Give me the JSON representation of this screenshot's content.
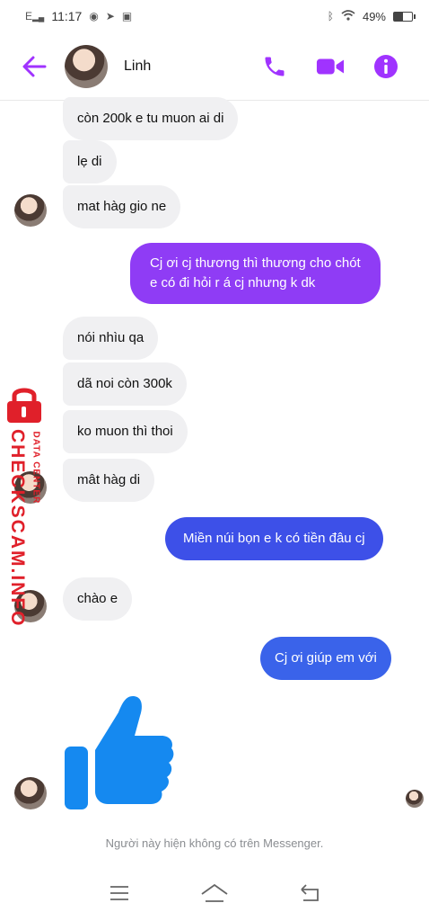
{
  "status_bar": {
    "signal_label": "E",
    "time": "11:17",
    "battery_percent": "49%",
    "battery_level": 0.49
  },
  "header": {
    "contact_name": "Linh",
    "accent_color": "#a033ff"
  },
  "messages": [
    {
      "direction": "in",
      "text": "còn 200k e tu muon ai di"
    },
    {
      "direction": "in",
      "text": "lẹ di"
    },
    {
      "direction": "in",
      "text": "mat hàg gio ne"
    },
    {
      "direction": "out",
      "text_lines": [
        "Cj ơi cj thương thì thương cho chót",
        "e có đi hỏi r á cj nhưng k dk"
      ],
      "color": "#8f3cf5"
    },
    {
      "direction": "in",
      "text": "nói nhìu qa"
    },
    {
      "direction": "in",
      "text": "dã noi còn 300k"
    },
    {
      "direction": "in",
      "text": "ko muon thì thoi"
    },
    {
      "direction": "in",
      "text": "mât hàg di"
    },
    {
      "direction": "out",
      "text": "Miền núi bọn e k có tiền đâu cj",
      "color": "#3d50e8"
    },
    {
      "direction": "in",
      "text": "chào e"
    },
    {
      "direction": "out",
      "text": "Cj ơi giúp em với",
      "color": "#3a63ea"
    },
    {
      "direction": "in",
      "sticker": "thumbs-up",
      "color": "#1589f0"
    }
  ],
  "watermark": {
    "brand": "CHECKSCAM.INFO",
    "tagline": "DATA CENTER",
    "color": "#e0202a"
  },
  "footer": {
    "notice": "Người này hiện không có trên Messenger."
  }
}
